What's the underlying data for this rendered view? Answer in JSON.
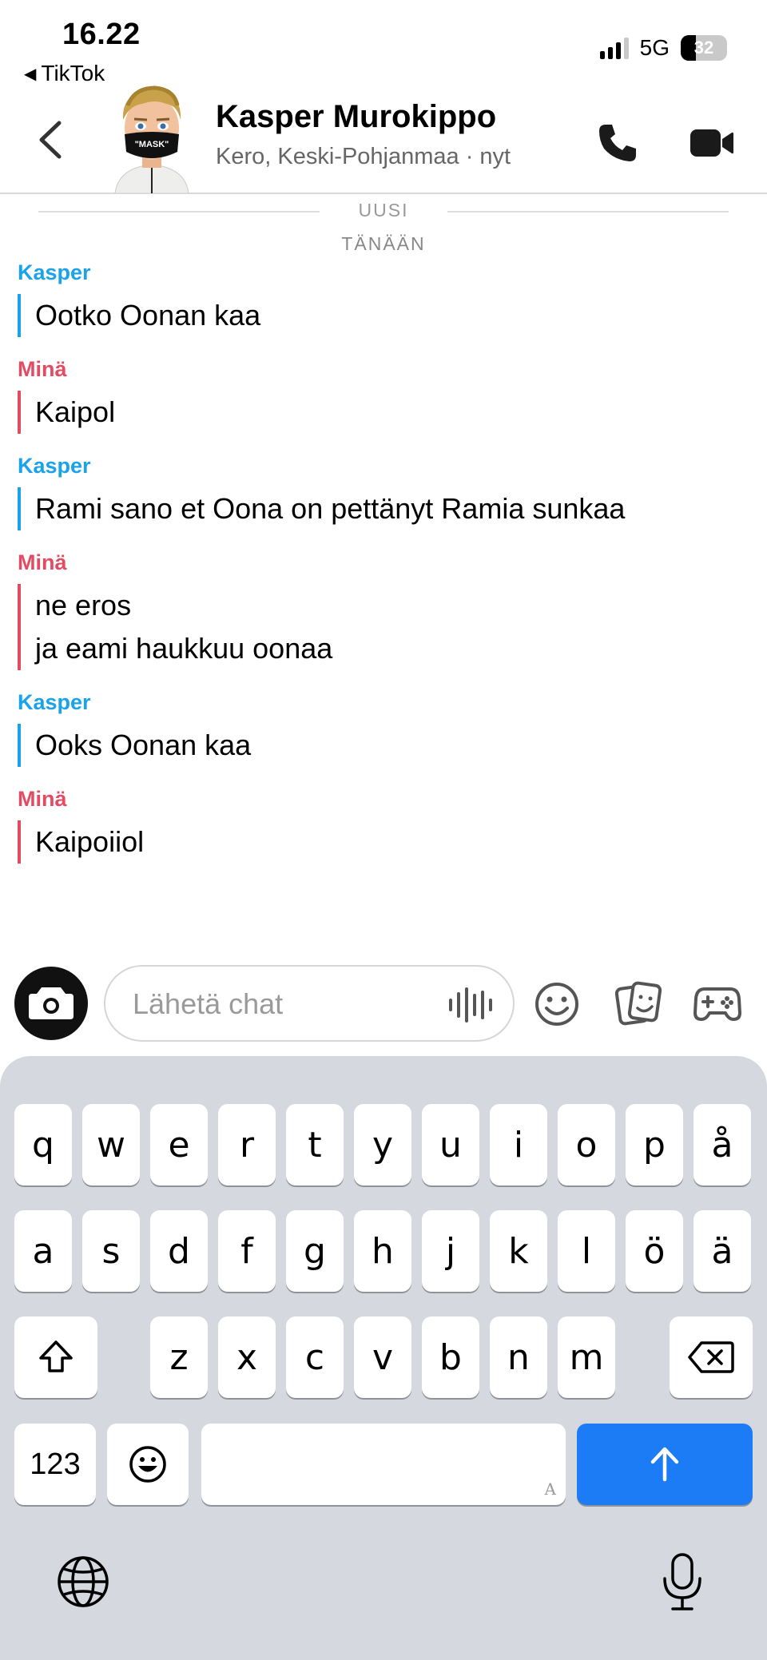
{
  "status_bar": {
    "time": "16.22",
    "back_app": "TikTok",
    "network": "5G",
    "battery": "32"
  },
  "header": {
    "name": "Kasper Murokippo",
    "subtitle": "Kero, Keski-Pohjanmaa · nyt",
    "avatar_text": "\"MASK\""
  },
  "dividers": {
    "new": "UUSI",
    "date": "TÄNÄÄN"
  },
  "messages": [
    {
      "sender": "Kasper",
      "lines": [
        "Ootko Oonan kaa"
      ]
    },
    {
      "sender": "Minä",
      "lines": [
        "Kaipol"
      ]
    },
    {
      "sender": "Kasper",
      "lines": [
        "Rami sano et Oona on pettänyt Ramia sunkaa"
      ]
    },
    {
      "sender": "Minä",
      "lines": [
        "ne eros",
        "ja eami haukkuu oonaa"
      ]
    },
    {
      "sender": "Kasper",
      "lines": [
        "Ooks Oonan kaa"
      ]
    },
    {
      "sender": "Minä",
      "lines": [
        "Kaipoiiol"
      ]
    }
  ],
  "input": {
    "placeholder": "Lähetä chat"
  },
  "colors": {
    "kasper": "#1aa3e8",
    "mina": "#e34b63",
    "return_key": "#1b7cf5",
    "keyboard_bg": "#d5d8de"
  },
  "keyboard": {
    "row1": [
      "q",
      "w",
      "e",
      "r",
      "t",
      "y",
      "u",
      "i",
      "o",
      "p",
      "å"
    ],
    "row2": [
      "a",
      "s",
      "d",
      "f",
      "g",
      "h",
      "j",
      "k",
      "l",
      "ö",
      "ä"
    ],
    "row3": [
      "z",
      "x",
      "c",
      "v",
      "b",
      "n",
      "m"
    ],
    "numbers_key": "123",
    "space_hint": "A",
    "icons": [
      "shift-icon",
      "backspace-icon",
      "emoji-key-icon",
      "return-arrow-icon",
      "globe-icon",
      "microphone-icon"
    ]
  }
}
